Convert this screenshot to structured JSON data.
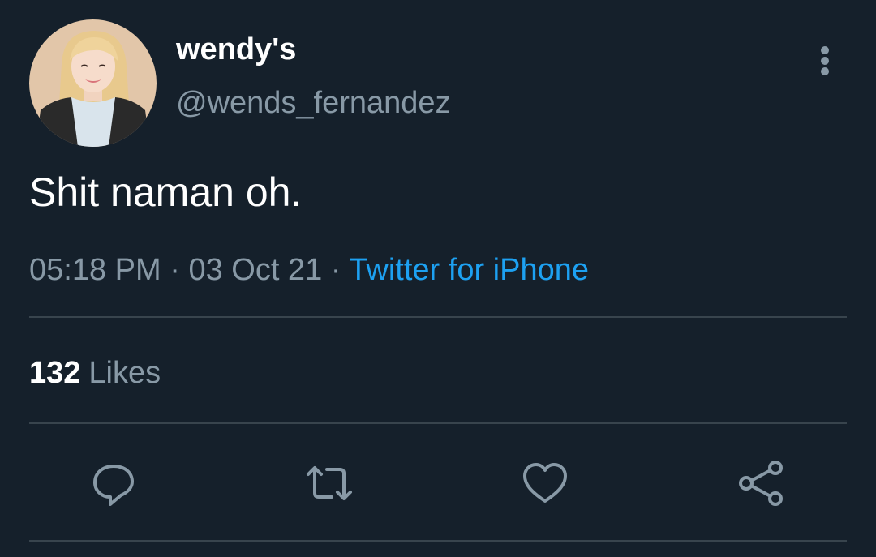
{
  "tweet": {
    "display_name": "wendy's",
    "handle": "@wends_fernandez",
    "text": "Shit naman oh.",
    "time": "05:18 PM",
    "date": "03 Oct 21",
    "separator": "·",
    "source": "Twitter for iPhone",
    "likes_count": "132",
    "likes_label": "Likes"
  },
  "icons": {
    "more": "more-vertical-icon",
    "reply": "reply-icon",
    "retweet": "retweet-icon",
    "like": "heart-icon",
    "share": "share-icon"
  },
  "colors": {
    "background": "#15202b",
    "primary_text": "#ffffff",
    "secondary_text": "#8899a6",
    "accent": "#1da1f2",
    "divider": "#38444d"
  }
}
